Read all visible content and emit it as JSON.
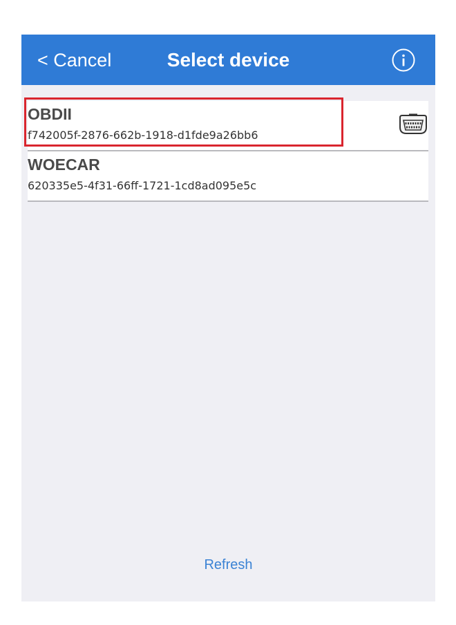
{
  "navbar": {
    "cancel_label": "< Cancel",
    "title": "Select device",
    "info_icon": "info-circle-icon",
    "background_color": "#2f7bd6"
  },
  "devices": [
    {
      "name": "OBDII",
      "id": "f742005f-2876-662b-1918-d1fde9a26bb6",
      "icon": "obd-connector-icon",
      "highlighted": true
    },
    {
      "name": "WOECAR",
      "id": "620335e5-4f31-66ff-1721-1cd8ad095e5c"
    }
  ],
  "refresh_label": "Refresh",
  "colors": {
    "accent": "#3a82d4",
    "highlight": "#d9252e",
    "background": "#efeff4"
  }
}
